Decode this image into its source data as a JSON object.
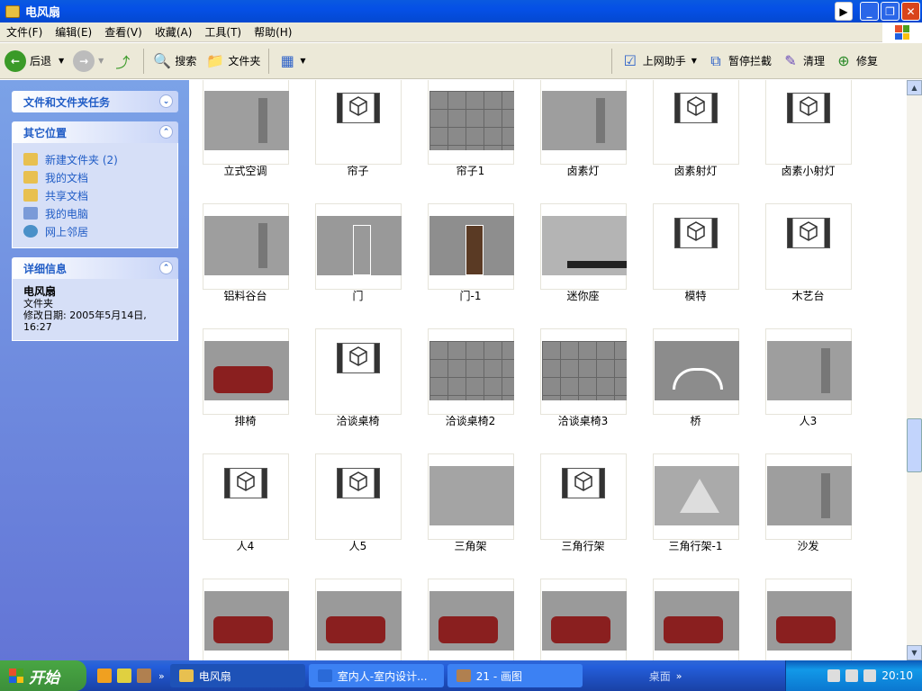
{
  "window": {
    "title": "电风扇"
  },
  "menu": [
    "文件(F)",
    "编辑(E)",
    "查看(V)",
    "收藏(A)",
    "工具(T)",
    "帮助(H)"
  ],
  "toolbar": {
    "back": "后退",
    "search": "搜索",
    "folders": "文件夹",
    "assistant": "上网助手",
    "block": "暂停拦截",
    "clean": "清理",
    "repair": "修复"
  },
  "sidebar": {
    "tasks_title": "文件和文件夹任务",
    "other_title": "其它位置",
    "places": [
      "新建文件夹 (2)",
      "我的文档",
      "共享文档",
      "我的电脑",
      "网上邻居"
    ],
    "details_title": "详细信息",
    "details_name": "电风扇",
    "details_type": "文件夹",
    "details_modified": "修改日期: 2005年5月14日, 16:27"
  },
  "files": [
    [
      "立式空调",
      "帘子",
      "帘子1",
      "卤素灯",
      "卤素射灯",
      "卤素小射灯"
    ],
    [
      "铝料谷台",
      "门",
      "门-1",
      "迷你座",
      "模特",
      "木艺台"
    ],
    [
      "排椅",
      "洽谈桌椅",
      "洽谈桌椅2",
      "洽谈桌椅3",
      "桥",
      "人3"
    ],
    [
      "人4",
      "人5",
      "三角架",
      "三角行架",
      "三角行架-1",
      "沙发"
    ],
    [
      "",
      "",
      "",
      "",
      "",
      ""
    ]
  ],
  "taskbar": {
    "start": "开始",
    "tasks": [
      "电风扇",
      "室内人-室内设计...",
      "21 - 画图"
    ],
    "desktop": "桌面",
    "time": "20:10"
  }
}
